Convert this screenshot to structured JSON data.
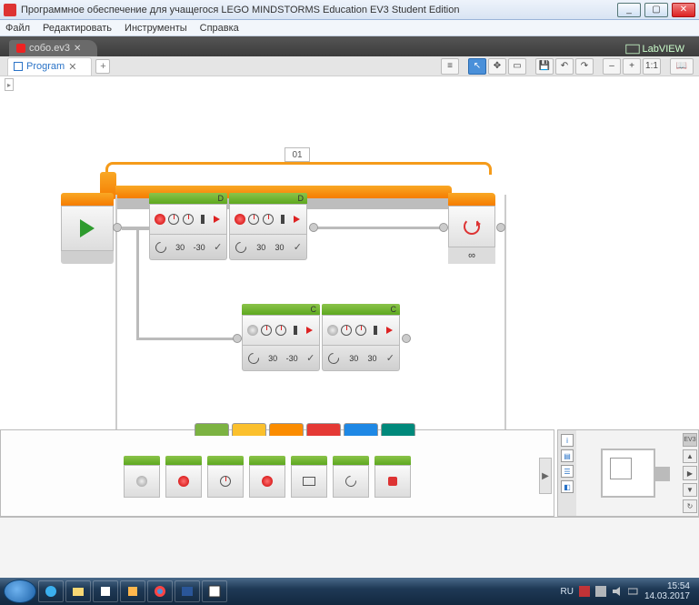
{
  "window": {
    "title": "Программное обеспечение для учащегося LEGO MINDSTORMS Education EV3 Student Edition",
    "min": "_",
    "max": "▢",
    "close": "✕"
  },
  "menu": {
    "file": "Файл",
    "edit": "Редактировать",
    "tools": "Инструменты",
    "help": "Справка"
  },
  "project_tab": {
    "name": "собо.ev3",
    "close": "✕"
  },
  "labview": "LabVIEW",
  "program_tab": {
    "name": "Program",
    "close": "✕",
    "add": "+"
  },
  "toolbar": {
    "list": "≡",
    "pointer": "↖",
    "pan": "✥",
    "select": "▭",
    "save": "💾",
    "undo": "↶",
    "redo": "↷",
    "zoom_out": "–",
    "zoom_in": "+",
    "fit": "1:1",
    "help": "📖"
  },
  "loop": {
    "label": "01",
    "end_mode": "∞"
  },
  "blocks": {
    "top1": {
      "port": "D",
      "v1": "30",
      "v2": "-30",
      "v3": "✓"
    },
    "top2": {
      "port": "D",
      "v1": "30",
      "v2": "30",
      "v3": "✓"
    },
    "bot1": {
      "port": "C",
      "v1": "30",
      "v2": "-30",
      "v3": "✓"
    },
    "bot2": {
      "port": "C",
      "v1": "30",
      "v2": "30",
      "v3": "✓"
    }
  },
  "palette": {
    "tabs": [
      "#7cb342",
      "#fbc02d",
      "#fb8c00",
      "#e53935",
      "#1e88e5",
      "#00897b"
    ],
    "items": [
      "motor-med",
      "motor-lg",
      "move-steer",
      "move-tank",
      "display",
      "sound",
      "brick-led"
    ]
  },
  "hw": {
    "badge": "EV3",
    "side": [
      "i",
      "▤",
      "☰",
      "◧"
    ],
    "ctrl": [
      "▲",
      "▶",
      "▼",
      "↻"
    ]
  },
  "taskbar": {
    "lang": "RU",
    "time": "15:54",
    "date": "14.03.2017"
  }
}
